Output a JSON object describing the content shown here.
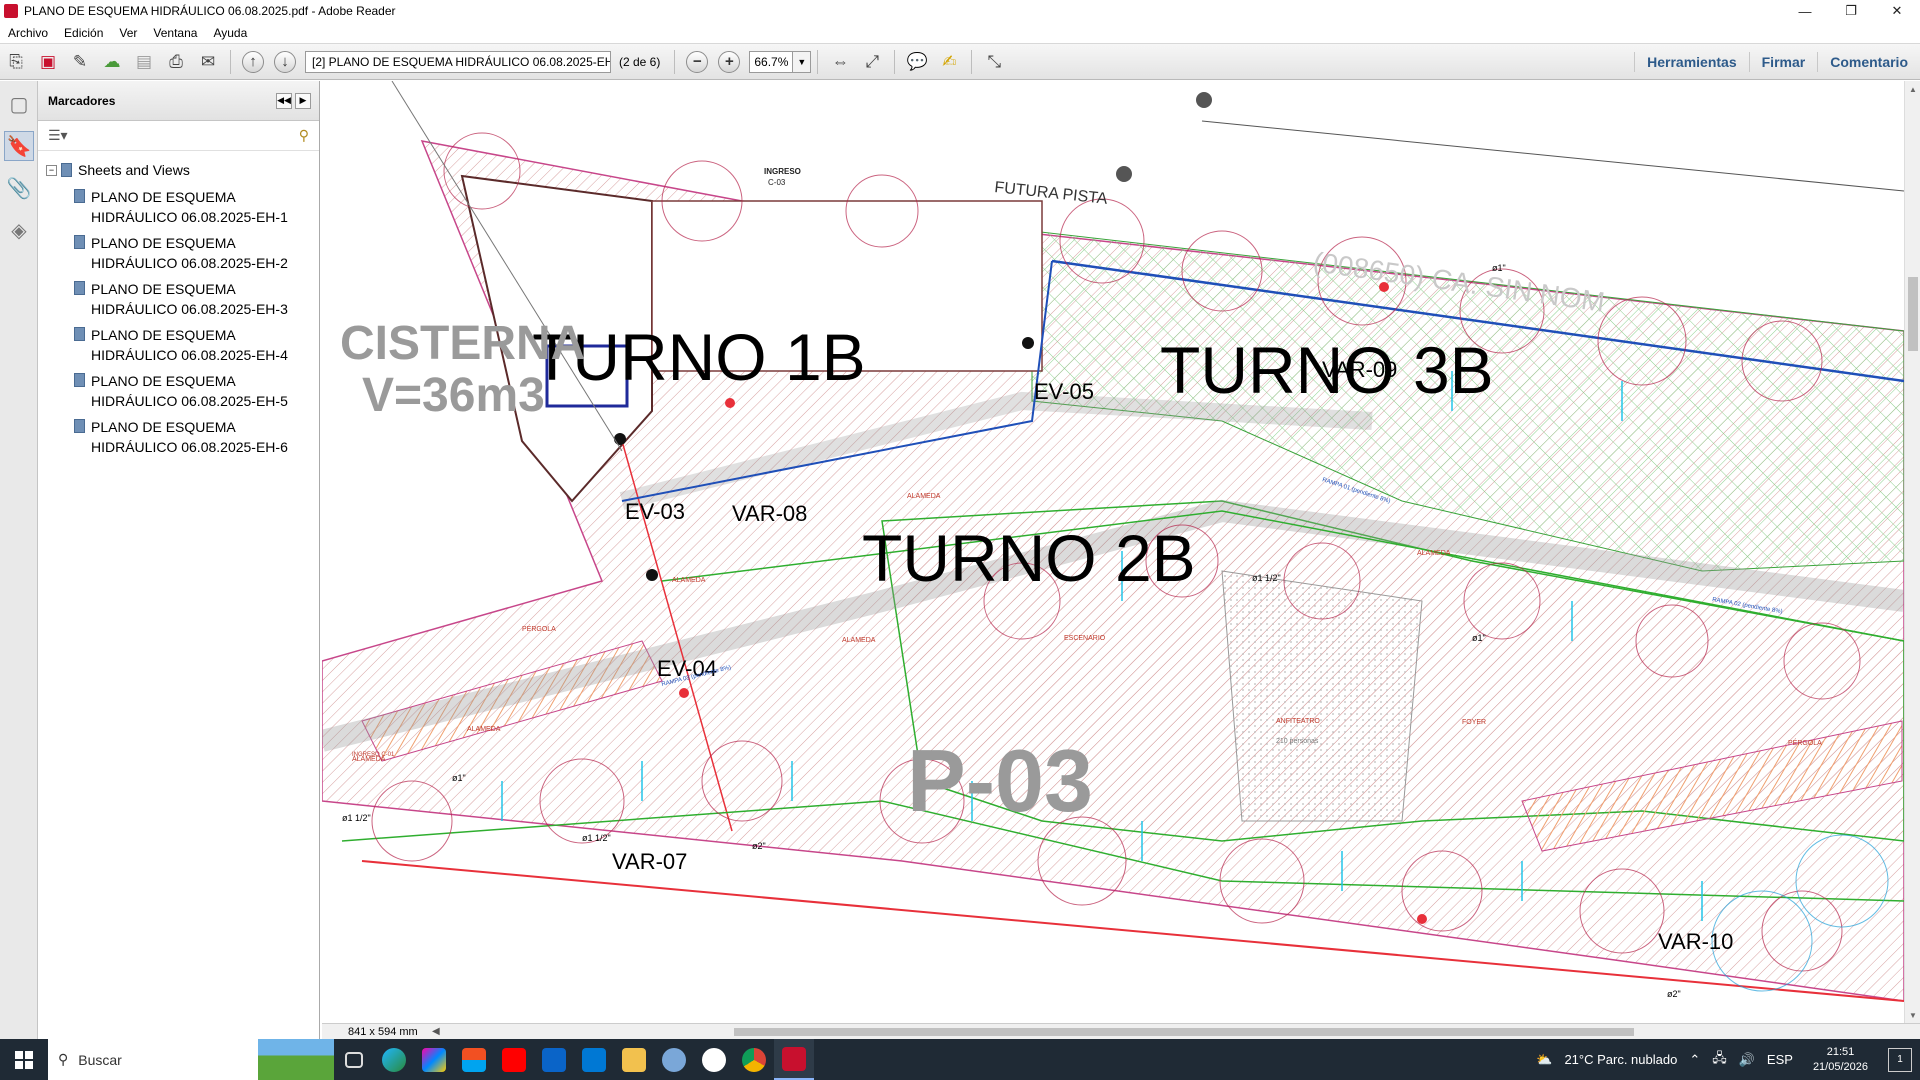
{
  "window": {
    "title": "PLANO DE ESQUEMA HIDRÁULICO 06.08.2025.pdf - Adobe Reader",
    "controls": [
      "—",
      "❐",
      "✕"
    ]
  },
  "menu": [
    "Archivo",
    "Edición",
    "Ver",
    "Ventana",
    "Ayuda"
  ],
  "toolbar": {
    "page_label": "[2] PLANO DE ESQUEMA HIDRÁULICO 06.08.2025-EH-2",
    "page_count": "(2 de 6)",
    "zoom": "66.7%",
    "zoom_out": "−",
    "zoom_in": "+",
    "links": [
      "Herramientas",
      "Firmar",
      "Comentario"
    ]
  },
  "bookmarks": {
    "header": "Marcadores",
    "root": "Sheets and Views",
    "items": [
      "PLANO DE ESQUEMA HIDRÁULICO 06.08.2025-EH-1",
      "PLANO DE ESQUEMA HIDRÁULICO 06.08.2025-EH-2",
      "PLANO DE ESQUEMA HIDRÁULICO 06.08.2025-EH-3",
      "PLANO DE ESQUEMA HIDRÁULICO 06.08.2025-EH-4",
      "PLANO DE ESQUEMA HIDRÁULICO 06.08.2025-EH-5",
      "PLANO DE ESQUEMA HIDRÁULICO 06.08.2025-EH-6"
    ]
  },
  "drawing": {
    "zones": [
      "TURNO 1B",
      "TURNO 3B",
      "TURNO 2B"
    ],
    "cistern": [
      "CISTERNA",
      "V=36m3"
    ],
    "sheet_code": "P-03",
    "valves": [
      "EV-03",
      "EV-04",
      "EV-05",
      "VAR-07",
      "VAR-08",
      "VAR-09",
      "VAR-10"
    ],
    "street": "(008650) CA. SIN NOM",
    "future": "FUTURA PISTA",
    "labels": [
      "ALAMEDA",
      "ALAMEDA",
      "ALAMEDA",
      "ALAMEDA",
      "ALAMEDA",
      "ALAMEDA",
      "PÉRGOLA",
      "PÉRGOLA",
      "ESCENARIO",
      "ANFITEATRO",
      "210 personas",
      "FOYER",
      "INGRESO",
      "C-03",
      "INGRESO C-01",
      "RAMPA 01 (pendiente 8%)",
      "RAMPA 02 (pendiente 8%)",
      "RAMPA 03 (pendiente 8%)"
    ],
    "pipes": [
      "ø1 1/2\"",
      "ø1\"",
      "ø2\"",
      "ø1 1/2\"",
      "ø1\"",
      "ø2\"",
      "ø1 1/2\"",
      "ø1\""
    ]
  },
  "status": {
    "page_size": "841 x 594 mm"
  },
  "taskbar": {
    "search": "Buscar",
    "weather": "21°C  Parc. nublado",
    "lang": "ESP",
    "time": "21:51",
    "date": "21/05/2026",
    "notifications": "1"
  },
  "colors": {
    "pipe_red": "#e8303a",
    "pipe_blue": "#1f4fb8",
    "pipe_green": "#2fae2f",
    "hatch_red": "#c07a7a",
    "hatch_green": "#3aa33a",
    "sprinkler_cyan": "#22c4e8",
    "accent_link": "#2d5a8a"
  }
}
